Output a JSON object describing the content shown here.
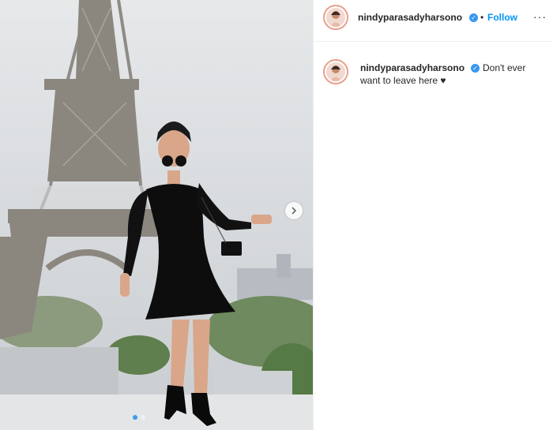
{
  "post": {
    "username": "nindyparasadyharsono",
    "verified_icon": "verified-badge-icon",
    "separator": "•",
    "follow_label": "Follow",
    "more_icon": "more-options-icon",
    "more_glyph": "···",
    "next_icon": "chevron-right-icon",
    "carousel": {
      "count": 2,
      "active_index": 0
    }
  },
  "caption": {
    "username": "nindyparasadyharsono",
    "text_line1": "Don't ever",
    "text_line2": "want to leave here ♥"
  },
  "colors": {
    "link": "#0095f6",
    "verified": "#3897f0",
    "avatar_ring": "#e9a08d",
    "text": "#262626"
  }
}
